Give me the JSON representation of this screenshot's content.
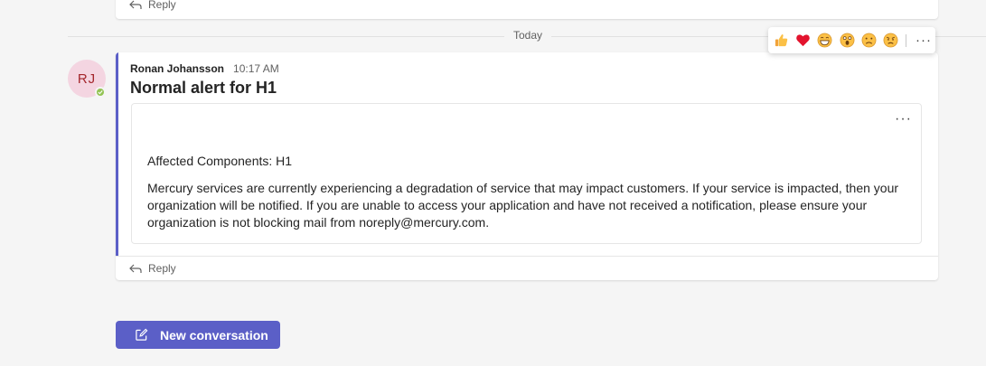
{
  "previous_post": {
    "reply_label": "Reply"
  },
  "divider": {
    "date_label": "Today"
  },
  "message": {
    "avatar_initials": "RJ",
    "author": "Ronan Johansson",
    "time": "10:17 AM",
    "title": "Normal alert for H1",
    "card": {
      "components_line": "Affected Components: H1",
      "body": "Mercury services are currently experiencing a degradation of service that may impact customers. If your service is impacted, then your organization will be notified. If you are unable to access your application and have not received a notification, please ensure your organization is not blocking mail from noreply@mercury.com.",
      "more_label": "···"
    },
    "reply_label": "Reply"
  },
  "reactions": {
    "items": [
      "like",
      "heart",
      "laugh",
      "surprised",
      "sad",
      "angry"
    ],
    "more_label": "···"
  },
  "new_conversation": {
    "label": "New conversation"
  },
  "colors": {
    "accent": "#5b5fc7",
    "presence_available": "#92c353",
    "avatar_bg": "#f4d5e1",
    "avatar_fg": "#a4262c"
  }
}
